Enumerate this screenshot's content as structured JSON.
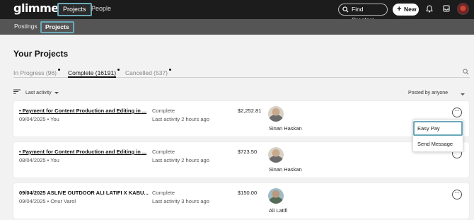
{
  "app": {
    "logo": "glimmer",
    "nav": {
      "projects": "Projects",
      "people": "People"
    },
    "find_creators": "Find Creators",
    "new_button": "New"
  },
  "subnav": {
    "postings": "Postings",
    "projects": "Projects"
  },
  "page": {
    "title": "Your Projects",
    "tabs": [
      {
        "label": "In Progress (96)"
      },
      {
        "label": "Complete (16191)"
      },
      {
        "label": "Cancelled (537)"
      }
    ],
    "sort_label": "Last activity",
    "posted_by_label": "Posted by anyone"
  },
  "projects": [
    {
      "title": "Payment for Content Production and Editing in ...",
      "meta": "09/04/2025 • You",
      "status": "Complete",
      "last_activity": "Last activity 2 hours ago",
      "amount": "$2,252.81",
      "person": "Sinan Haskan"
    },
    {
      "title": "Payment for Content Production and Editing in ...",
      "meta": "08/04/2025 • You",
      "status": "Complete",
      "last_activity": "Last activity 2 hours ago",
      "amount": "$723.50",
      "person": "Sinan Haskan"
    },
    {
      "title": "09/04/2025 ASLIVE OUTDOOR ALI LATIFI X KABU...",
      "meta": "09/04/2025 • Onur Varol",
      "status": "Complete",
      "last_activity": "Last activity 3 hours ago",
      "amount": "$150.00",
      "person": "Ali Latifi"
    }
  ],
  "more_menu": {
    "easy_pay": "Easy Pay",
    "send_message": "Send Message"
  },
  "more_glyph": "···",
  "bullet": "•",
  "plus_glyph": "+",
  "icons": [
    "search-icon",
    "bell-icon",
    "inbox-icon",
    "filter-icon",
    "more-icon"
  ],
  "colors": {
    "nav_bg": "#1c1c1c",
    "subnav_bg": "#555555",
    "focus_ring": "#6aa9b8"
  }
}
